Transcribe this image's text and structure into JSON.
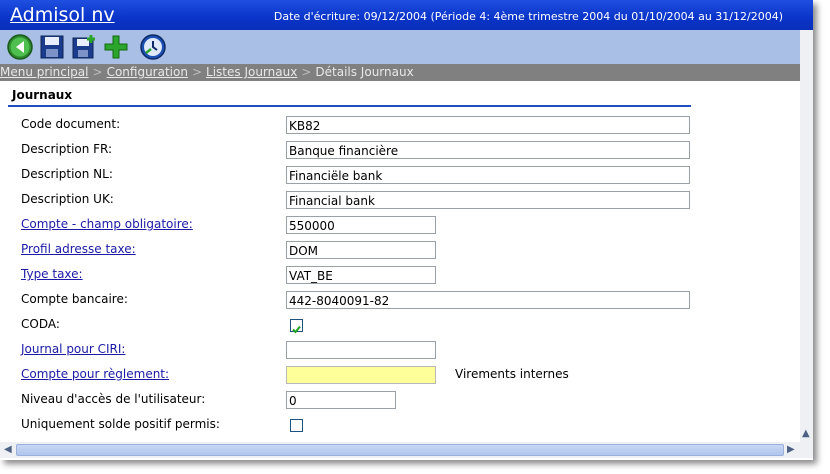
{
  "window": {
    "app_title": "Admisol nv",
    "date_info": "Date d'écriture: 09/12/2004 (Période 4: 4ème trimestre 2004 du 01/10/2004 au 31/12/2004)"
  },
  "toolbar": {
    "icons": [
      "back-icon",
      "save-icon",
      "save-new-icon",
      "add-icon",
      "clock-icon"
    ]
  },
  "breadcrumb": {
    "items": [
      "Menu principal",
      "Configuration",
      "Listes Journaux"
    ],
    "current": "Détails Journaux",
    "separator": ">"
  },
  "section": {
    "title": "Journaux"
  },
  "form": {
    "code_document": {
      "label": "Code document:",
      "value": "KB82"
    },
    "description_fr": {
      "label": "Description FR:",
      "value": "Banque financière"
    },
    "description_nl": {
      "label": "Description NL:",
      "value": "Financiële bank"
    },
    "description_uk": {
      "label": "Description UK:",
      "value": "Financial bank"
    },
    "compte": {
      "label": "Compte - champ obligatoire:",
      "value": "550000"
    },
    "profil_adresse_taxe": {
      "label": "Profil adresse taxe:",
      "value": "DOM"
    },
    "type_taxe": {
      "label": "Type taxe:",
      "value": "VAT_BE"
    },
    "compte_bancaire": {
      "label": "Compte bancaire:",
      "value": "442-8040091-82"
    },
    "coda": {
      "label": "CODA:",
      "checked": true
    },
    "journal_ciri": {
      "label": "Journal pour CIRI:",
      "value": ""
    },
    "compte_reglement": {
      "label": "Compte pour règlement:",
      "value": "",
      "extra": "Virements internes"
    },
    "niveau_acces": {
      "label": "Niveau d'accès de l'utilisateur:",
      "value": "0"
    },
    "solde_positif": {
      "label": "Uniquement solde positif permis:",
      "checked": false
    }
  },
  "colors": {
    "titlebar": "#0a34c9",
    "toolbar": "#a9bfe5",
    "breadcrumb": "#808080",
    "link": "#1a1aa6",
    "highlight_field": "#ffff99"
  }
}
